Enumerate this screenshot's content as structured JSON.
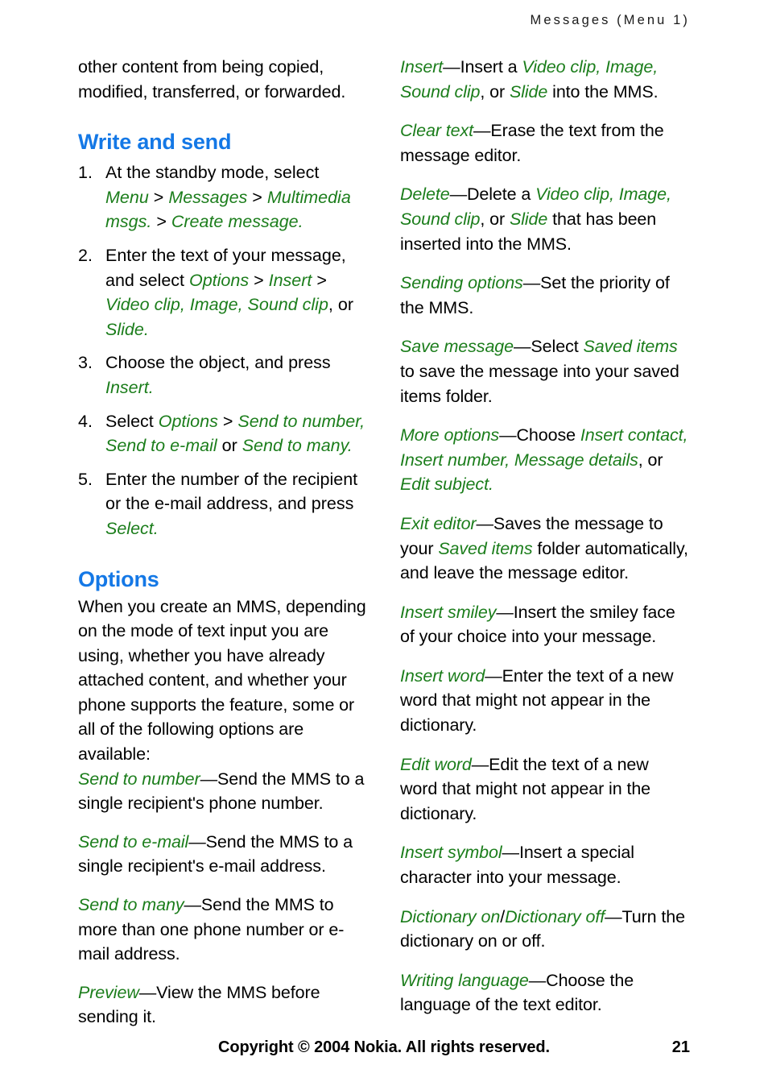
{
  "header": {
    "running_head": "Messages (Menu 1)"
  },
  "colors": {
    "heading_blue": "#1478E6",
    "ui_term_green": "#1B7D1B",
    "body_black": "#000000",
    "page_background": "#FFFFFF"
  },
  "left_column": {
    "continued_paragraph": "other content from being copied, modified, transferred, or forwarded.",
    "heading_write_and_send": "Write and send",
    "steps": [
      {
        "number": "1.",
        "parts": [
          {
            "text": "At the standby mode, select ",
            "style": "plain"
          },
          {
            "text": "Menu",
            "style": "ui"
          },
          {
            "text": " > ",
            "style": "plain"
          },
          {
            "text": "Messages",
            "style": "ui"
          },
          {
            "text": " > ",
            "style": "plain"
          },
          {
            "text": "Multimedia msgs.",
            "style": "ui"
          },
          {
            "text": " > ",
            "style": "plain"
          },
          {
            "text": "Create message",
            "style": "ui"
          },
          {
            "text": ".",
            "style": "ui"
          }
        ]
      },
      {
        "number": "2.",
        "parts": [
          {
            "text": "Enter the text of your message, and select ",
            "style": "plain"
          },
          {
            "text": "Options",
            "style": "ui"
          },
          {
            "text": " > ",
            "style": "plain"
          },
          {
            "text": "Insert",
            "style": "ui"
          },
          {
            "text": " > ",
            "style": "plain"
          },
          {
            "text": "Video clip",
            "style": "ui"
          },
          {
            "text": ", ",
            "style": "ui"
          },
          {
            "text": "Image",
            "style": "ui"
          },
          {
            "text": ", ",
            "style": "ui"
          },
          {
            "text": "Sound clip",
            "style": "ui"
          },
          {
            "text": ", or ",
            "style": "plain"
          },
          {
            "text": "Slide",
            "style": "ui"
          },
          {
            "text": ".",
            "style": "ui"
          }
        ]
      },
      {
        "number": "3.",
        "parts": [
          {
            "text": "Choose the object, and press ",
            "style": "plain"
          },
          {
            "text": "Insert",
            "style": "ui"
          },
          {
            "text": ".",
            "style": "ui"
          }
        ]
      },
      {
        "number": "4.",
        "parts": [
          {
            "text": "Select ",
            "style": "plain"
          },
          {
            "text": "Options",
            "style": "ui"
          },
          {
            "text": " > ",
            "style": "plain"
          },
          {
            "text": "Send to number",
            "style": "ui"
          },
          {
            "text": ", ",
            "style": "ui"
          },
          {
            "text": "Send to e-mail",
            "style": "ui"
          },
          {
            "text": " or ",
            "style": "plain"
          },
          {
            "text": "Send to many",
            "style": "ui"
          },
          {
            "text": ".",
            "style": "ui"
          }
        ]
      },
      {
        "number": "5.",
        "parts": [
          {
            "text": "Enter the number of the recipient or the e-mail address, and press ",
            "style": "plain"
          },
          {
            "text": "Select",
            "style": "ui"
          },
          {
            "text": ".",
            "style": "ui"
          }
        ]
      }
    ],
    "heading_options": "Options",
    "options_intro": "When you create an MMS, depending on the mode of text input you are using, whether you have already attached content, and whether your phone supports the feature, some or all of the following options are available:",
    "definitions": [
      {
        "term": "Send to number",
        "parts": [
          {
            "text": "—Send the MMS to a single recipient's phone number.",
            "style": "plain"
          }
        ]
      },
      {
        "term": "Send to e-mail",
        "parts": [
          {
            "text": "—Send the MMS to a single recipient's e-mail address.",
            "style": "plain"
          }
        ]
      },
      {
        "term": "Send to many",
        "parts": [
          {
            "text": "—Send the MMS to more than one phone number or e-mail address.",
            "style": "plain"
          }
        ]
      },
      {
        "term": "Preview",
        "parts": [
          {
            "text": "—View the MMS before sending it.",
            "style": "plain"
          }
        ]
      }
    ]
  },
  "right_column": {
    "definitions": [
      {
        "term": "Insert",
        "parts": [
          {
            "text": "—Insert a ",
            "style": "plain"
          },
          {
            "text": "Video clip",
            "style": "ui"
          },
          {
            "text": ", ",
            "style": "ui"
          },
          {
            "text": "Image",
            "style": "ui"
          },
          {
            "text": ", ",
            "style": "ui"
          },
          {
            "text": "Sound clip",
            "style": "ui"
          },
          {
            "text": ", or ",
            "style": "plain"
          },
          {
            "text": "Slide",
            "style": "ui"
          },
          {
            "text": " into the MMS.",
            "style": "plain"
          }
        ]
      },
      {
        "term": "Clear text",
        "parts": [
          {
            "text": "—Erase the text from the message editor.",
            "style": "plain"
          }
        ]
      },
      {
        "term": "Delete",
        "parts": [
          {
            "text": "—Delete a ",
            "style": "plain"
          },
          {
            "text": "Video clip",
            "style": "ui"
          },
          {
            "text": ", ",
            "style": "ui"
          },
          {
            "text": "Image",
            "style": "ui"
          },
          {
            "text": ", ",
            "style": "ui"
          },
          {
            "text": "Sound clip",
            "style": "ui"
          },
          {
            "text": ", or ",
            "style": "plain"
          },
          {
            "text": "Slide",
            "style": "ui"
          },
          {
            "text": " that has been inserted into the MMS.",
            "style": "plain"
          }
        ]
      },
      {
        "term": "Sending options",
        "parts": [
          {
            "text": "—Set the priority of the MMS.",
            "style": "plain"
          }
        ]
      },
      {
        "term": "Save message",
        "parts": [
          {
            "text": "—Select ",
            "style": "plain"
          },
          {
            "text": "Saved items",
            "style": "ui"
          },
          {
            "text": " to save the message into your saved items folder.",
            "style": "plain"
          }
        ]
      },
      {
        "term": "More options",
        "parts": [
          {
            "text": "—Choose ",
            "style": "plain"
          },
          {
            "text": "Insert contact",
            "style": "ui"
          },
          {
            "text": ", ",
            "style": "ui"
          },
          {
            "text": "Insert number",
            "style": "ui"
          },
          {
            "text": ", ",
            "style": "ui"
          },
          {
            "text": "Message details",
            "style": "ui"
          },
          {
            "text": ", or ",
            "style": "plain"
          },
          {
            "text": "Edit subject",
            "style": "ui"
          },
          {
            "text": ".",
            "style": "ui"
          }
        ]
      },
      {
        "term": "Exit editor",
        "parts": [
          {
            "text": "—Saves the message to your ",
            "style": "plain"
          },
          {
            "text": "Saved items",
            "style": "ui"
          },
          {
            "text": " folder automatically, and leave the message editor.",
            "style": "plain"
          }
        ]
      },
      {
        "term": "Insert smiley",
        "parts": [
          {
            "text": "—Insert the smiley face of your choice into your message.",
            "style": "plain"
          }
        ]
      },
      {
        "term": "Insert word",
        "parts": [
          {
            "text": "—Enter the text of a new word that might not appear in the dictionary.",
            "style": "plain"
          }
        ]
      },
      {
        "term": "Edit word",
        "parts": [
          {
            "text": "—Edit the text of a new word that might not appear in the dictionary.",
            "style": "plain"
          }
        ]
      },
      {
        "term": "Insert symbol",
        "parts": [
          {
            "text": "—Insert a special character into your message.",
            "style": "plain"
          }
        ]
      },
      {
        "term": "Dictionary on",
        "parts": [
          {
            "text": "/",
            "style": "plain"
          },
          {
            "text": "Dictionary off",
            "style": "ui"
          },
          {
            "text": "—Turn the dictionary on or off.",
            "style": "plain"
          }
        ]
      },
      {
        "term": "Writing language",
        "parts": [
          {
            "text": "—Choose the language of the text editor.",
            "style": "plain"
          }
        ]
      }
    ]
  },
  "footer": {
    "copyright": "Copyright © 2004 Nokia. All rights reserved.",
    "page_number": "21"
  }
}
